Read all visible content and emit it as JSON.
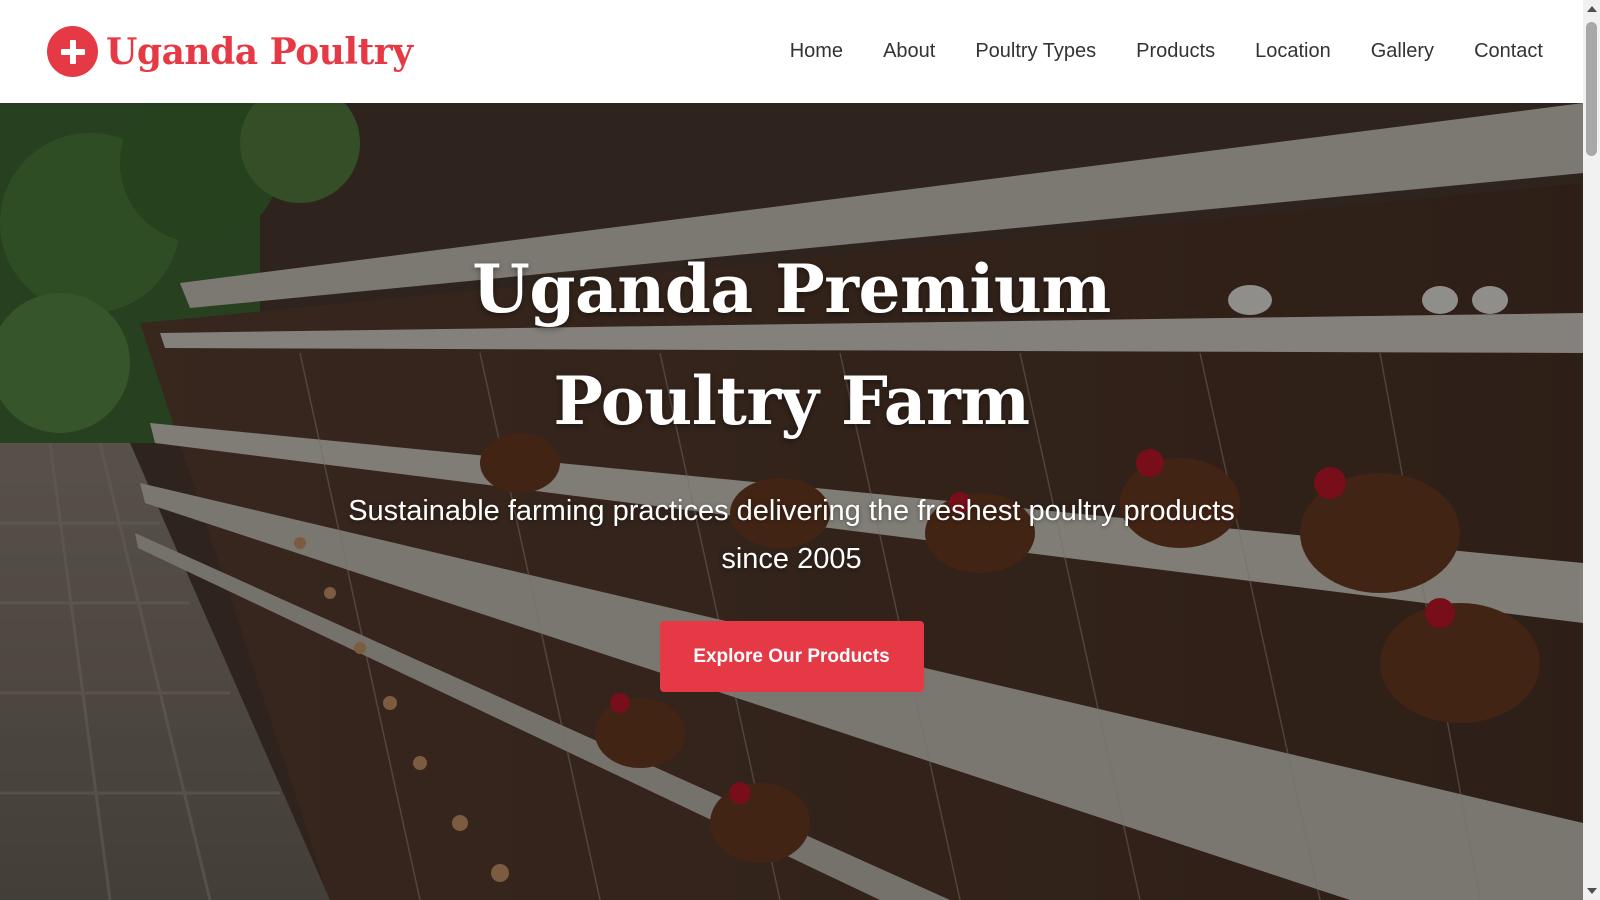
{
  "brand": {
    "name": "Uganda Poultry",
    "icon": "plus-circle-icon",
    "color": "#e63946"
  },
  "nav": {
    "items": [
      {
        "label": "Home"
      },
      {
        "label": "About"
      },
      {
        "label": "Poultry Types"
      },
      {
        "label": "Products"
      },
      {
        "label": "Location"
      },
      {
        "label": "Gallery"
      },
      {
        "label": "Contact"
      }
    ]
  },
  "hero": {
    "title": "Uganda Premium Poultry Farm",
    "subtitle": "Sustainable farming practices delivering the freshest poultry products since 2005",
    "cta_label": "Explore Our Products",
    "background": "layer-hen-cages-photo"
  },
  "colors": {
    "accent": "#e63946",
    "nav_text": "#333333",
    "hero_text": "#ffffff"
  }
}
